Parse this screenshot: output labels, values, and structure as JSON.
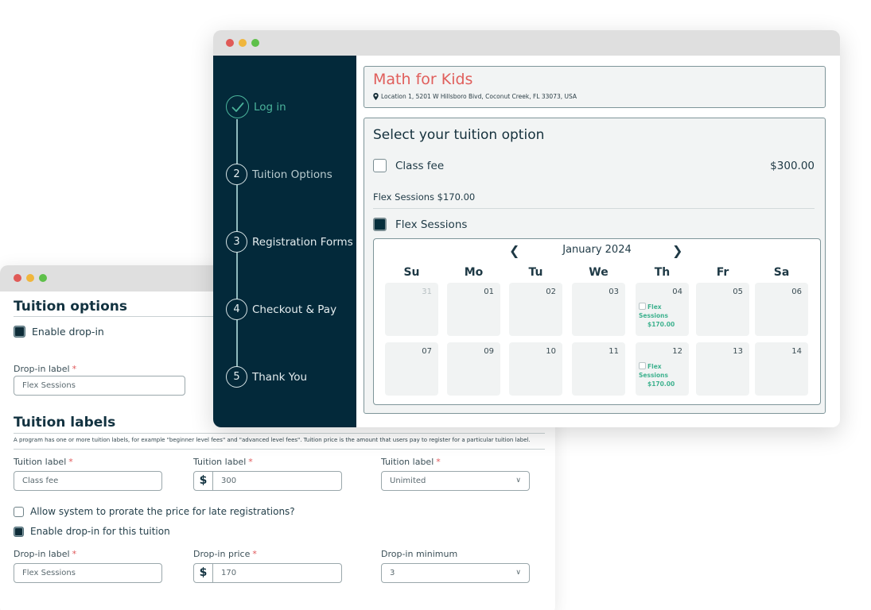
{
  "window_controls": {
    "close_color": "#e05a57",
    "minimize_color": "#f0b63c",
    "maximize_color": "#5ec04a"
  },
  "admin_form": {
    "tuition_options": {
      "heading": "Tuition options",
      "enable_dropin_label": "Enable drop-in",
      "enable_dropin_checked": true,
      "dropin_label_label": "Drop-in label",
      "dropin_label_value": "Flex Sessions"
    },
    "tuition_labels": {
      "heading": "Tuition labels",
      "description": "A program has one or more tuition labels, for example \"beginner level fees\" and \"advanced level fees\". Tuition price is the amount that users pay to register for a particular tuition label.",
      "field1_label": "Tuition label",
      "field1_value": "Class fee",
      "field2_label": "Tuition label",
      "field2_currency": "$",
      "field2_value": "300",
      "field3_label": "Tuition label",
      "field3_value": "Unimited",
      "prorate_label": "Allow system to prorate the price for late registrations?",
      "prorate_checked": false,
      "enable_dropin_tuition_label": "Enable drop-in for this tuition",
      "enable_dropin_tuition_checked": true,
      "dropin_label_label": "Drop-in label",
      "dropin_label_value": "Flex Sessions",
      "dropin_price_label": "Drop-in price",
      "dropin_price_currency": "$",
      "dropin_price_value": "170",
      "dropin_minimum_label": "Drop-in minimum",
      "dropin_minimum_value": "3"
    },
    "required_marker": "*"
  },
  "registration": {
    "steps": [
      {
        "number": "✓",
        "label": "Log in",
        "state": "done"
      },
      {
        "number": "2",
        "label": "Tuition Options",
        "state": "current"
      },
      {
        "number": "3",
        "label": "Registration Forms",
        "state": "upcoming"
      },
      {
        "number": "4",
        "label": "Checkout & Pay",
        "state": "upcoming"
      },
      {
        "number": "5",
        "label": "Thank You",
        "state": "upcoming"
      }
    ],
    "program": {
      "title": "Math for Kids",
      "location": "Location 1, 5201 W Hillsboro Bivd, Coconut Creek, FL 33073, USA",
      "title_color": "#e05e5b"
    },
    "tuition": {
      "heading": "Select your tuition option",
      "class_fee_label": "Class fee",
      "class_fee_price": "$300.00",
      "class_fee_checked": false,
      "flex_summary": "Flex Sessions $170.00",
      "flex_label": "Flex Sessions",
      "flex_checked": true
    },
    "calendar": {
      "month_label": "January 2024",
      "weekdays": [
        "Su",
        "Mo",
        "Tu",
        "We",
        "Th",
        "Fr",
        "Sa"
      ],
      "weeks": [
        [
          {
            "day": "31",
            "muted": true
          },
          {
            "day": "01"
          },
          {
            "day": "02"
          },
          {
            "day": "03"
          },
          {
            "day": "04",
            "event": {
              "name": "Flex Sessions",
              "price": "$170.00"
            }
          },
          {
            "day": "05"
          },
          {
            "day": "06"
          }
        ],
        [
          {
            "day": "07"
          },
          {
            "day": "09"
          },
          {
            "day": "10"
          },
          {
            "day": "11"
          },
          {
            "day": "12",
            "event": {
              "name": "Flex Sessions",
              "price": "$170.00"
            }
          },
          {
            "day": "13"
          },
          {
            "day": "14"
          }
        ]
      ],
      "event_color": "#3fb28f"
    }
  }
}
